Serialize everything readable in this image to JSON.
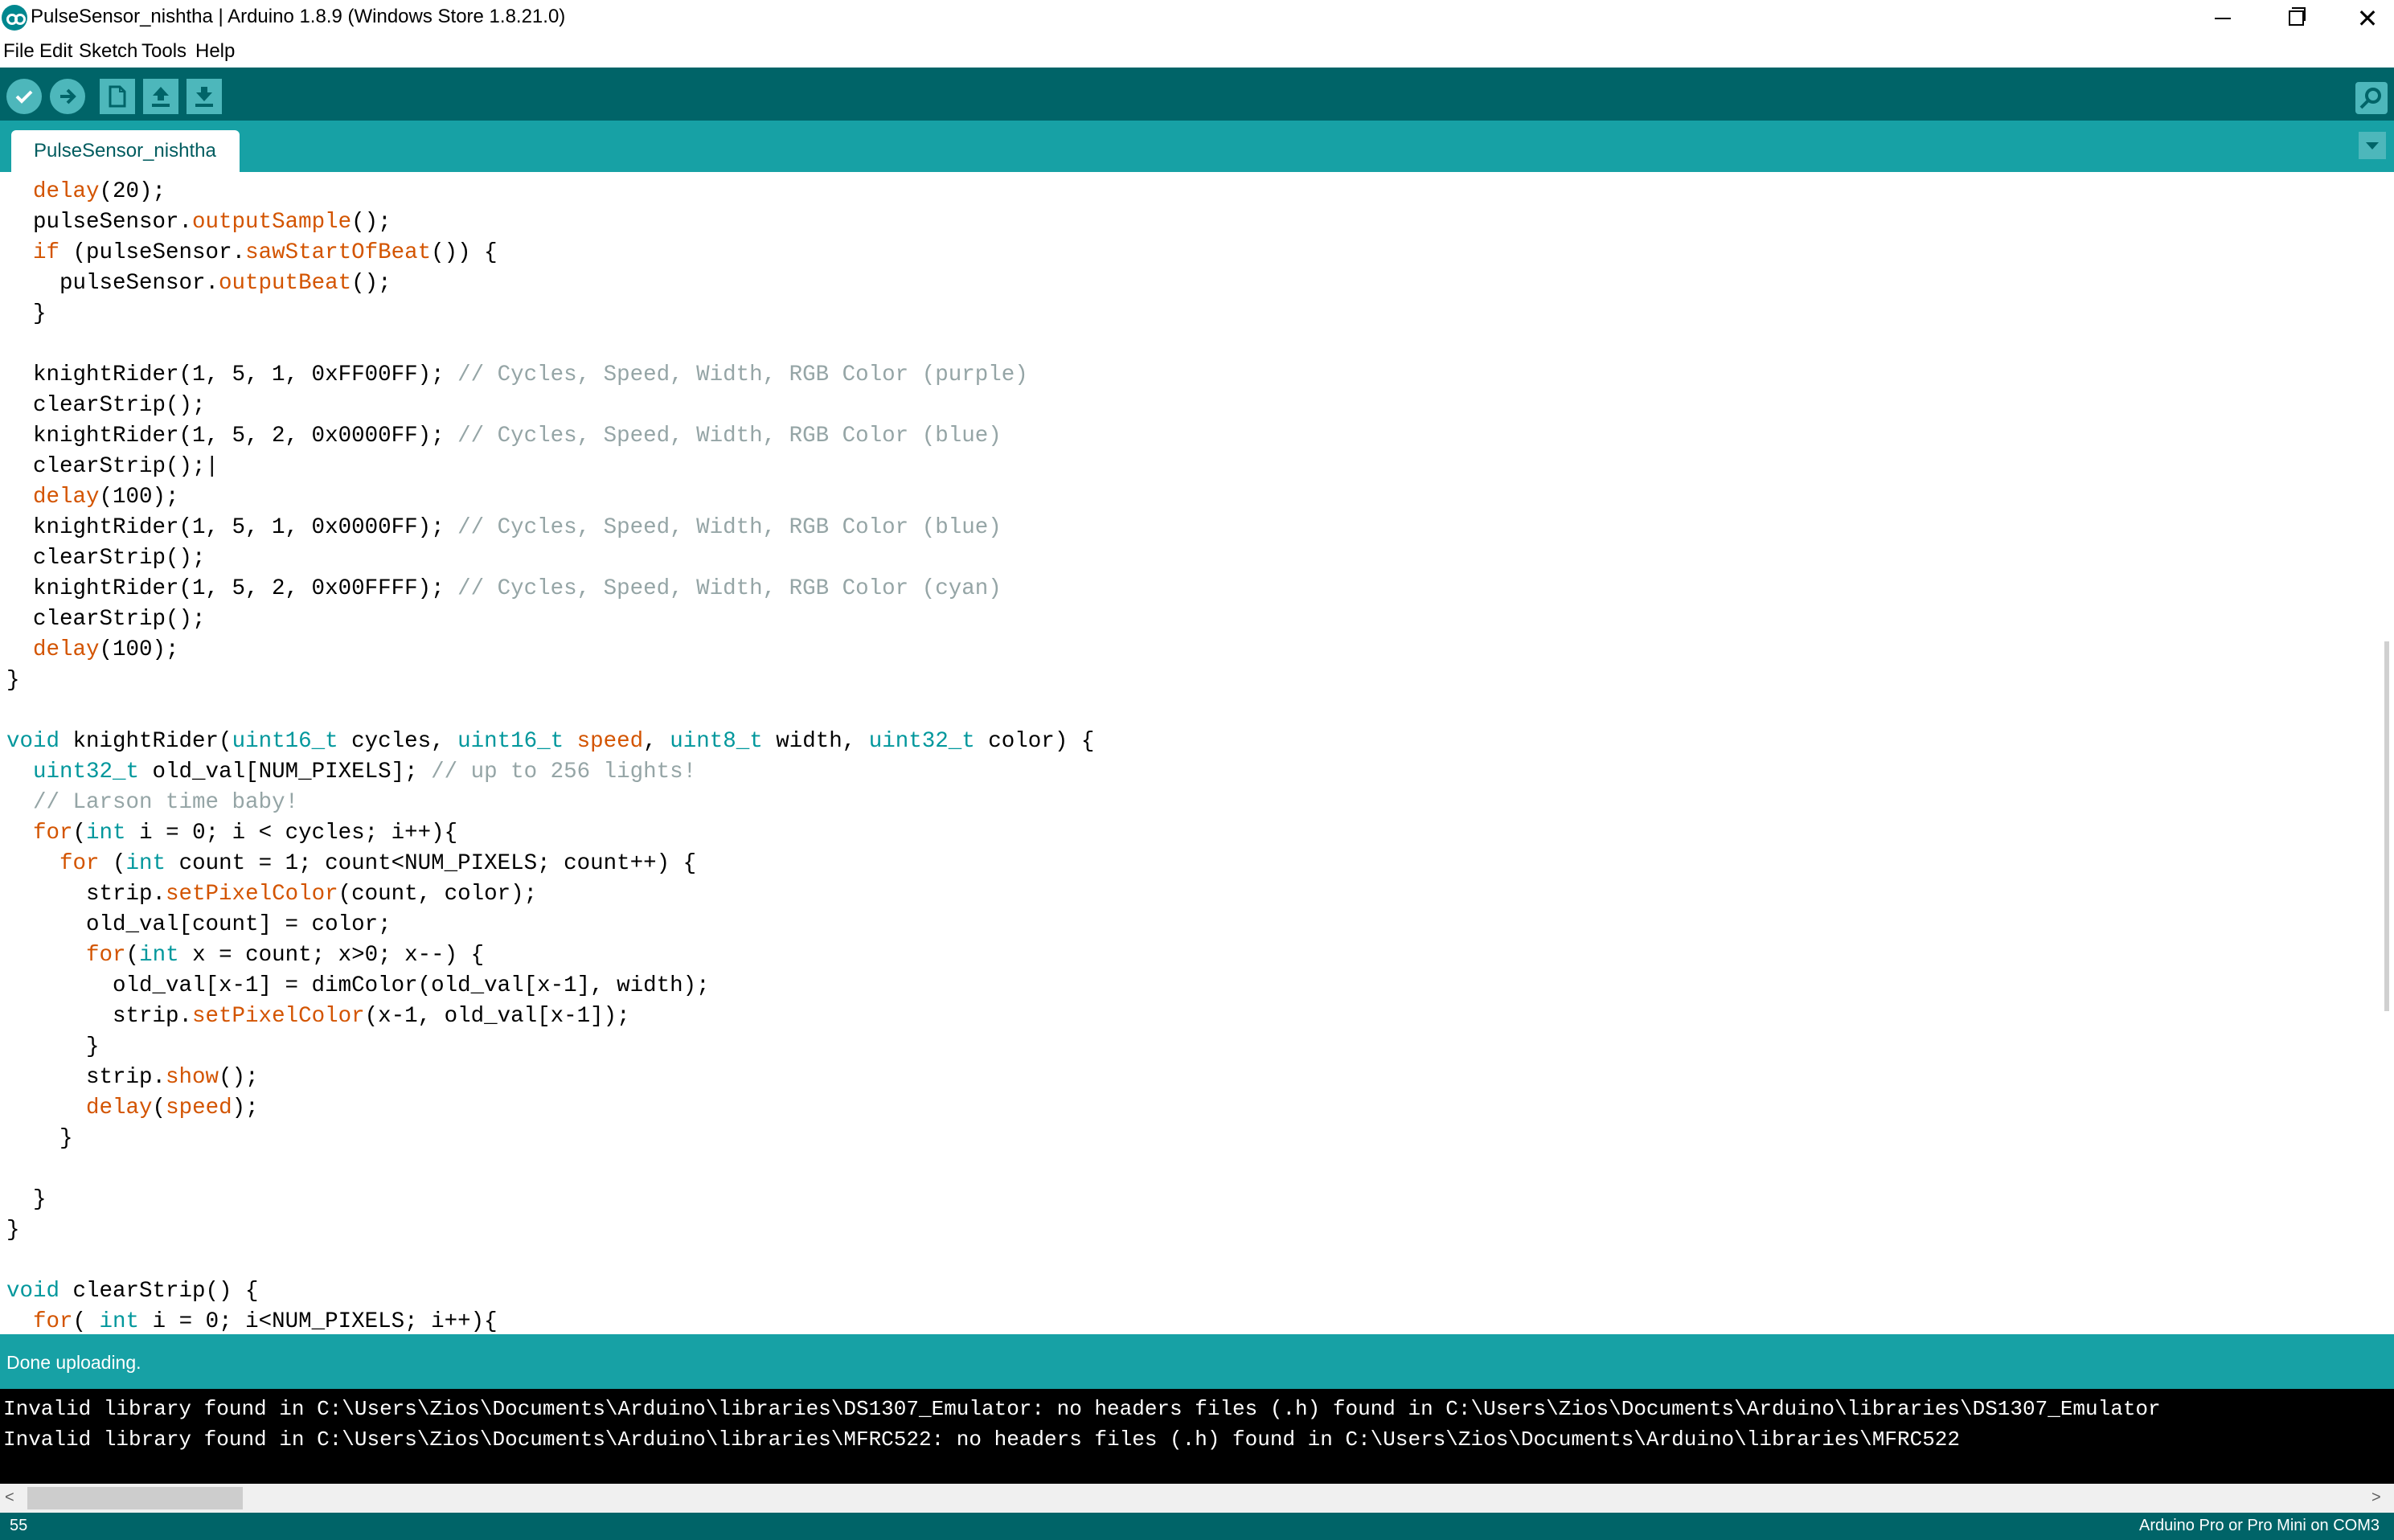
{
  "window": {
    "title": "PulseSensor_nishtha | Arduino 1.8.9 (Windows Store 1.8.21.0)",
    "minimize_glyph": "—",
    "close_glyph": "✕"
  },
  "menu": [
    "File",
    "Edit",
    "Sketch",
    "Tools",
    "Help"
  ],
  "toolbar": {
    "buttons": [
      "verify-icon",
      "upload-icon",
      "new-icon",
      "open-icon",
      "save-icon"
    ],
    "right_button": "serial-monitor-icon"
  },
  "tab": {
    "label": "PulseSensor_nishtha"
  },
  "colors": {
    "toolbar": "#006468",
    "tabbar": "#17a1a5",
    "keyword": "#d35400",
    "type": "#00979c",
    "comment": "#95a5a6"
  },
  "code_lines": [
    [
      [
        "  ",
        ""
      ],
      [
        "delay",
        "kw"
      ],
      [
        "(20);",
        ""
      ]
    ],
    [
      [
        "  pulseSensor.",
        ""
      ],
      [
        "outputSample",
        "kw"
      ],
      [
        "();",
        ""
      ]
    ],
    [
      [
        "  ",
        ""
      ],
      [
        "if",
        "kw"
      ],
      [
        " (pulseSensor.",
        ""
      ],
      [
        "sawStartOfBeat",
        "kw"
      ],
      [
        "()) {",
        ""
      ]
    ],
    [
      [
        "    pulseSensor.",
        ""
      ],
      [
        "outputBeat",
        "kw"
      ],
      [
        "();",
        ""
      ]
    ],
    [
      [
        "  }",
        ""
      ]
    ],
    [
      [
        "",
        ""
      ]
    ],
    [
      [
        "  knightRider(1, 5, 1, 0xFF00FF); ",
        ""
      ],
      [
        "// Cycles, Speed, Width, RGB Color (purple)",
        "cm"
      ]
    ],
    [
      [
        "  clearStrip();",
        ""
      ]
    ],
    [
      [
        "  knightRider(1, 5, 2, 0x0000FF); ",
        ""
      ],
      [
        "// Cycles, Speed, Width, RGB Color (blue)",
        "cm"
      ]
    ],
    [
      [
        "  clearStrip();|",
        ""
      ]
    ],
    [
      [
        "  ",
        ""
      ],
      [
        "delay",
        "kw"
      ],
      [
        "(100);",
        ""
      ]
    ],
    [
      [
        "  knightRider(1, 5, 1, 0x0000FF); ",
        ""
      ],
      [
        "// Cycles, Speed, Width, RGB Color (blue)",
        "cm"
      ]
    ],
    [
      [
        "  clearStrip();",
        ""
      ]
    ],
    [
      [
        "  knightRider(1, 5, 2, 0x00FFFF); ",
        ""
      ],
      [
        "// Cycles, Speed, Width, RGB Color (cyan)",
        "cm"
      ]
    ],
    [
      [
        "  clearStrip();",
        ""
      ]
    ],
    [
      [
        "  ",
        ""
      ],
      [
        "delay",
        "kw"
      ],
      [
        "(100);",
        ""
      ]
    ],
    [
      [
        "}",
        ""
      ]
    ],
    [
      [
        "",
        ""
      ]
    ],
    [
      [
        "void",
        "ty"
      ],
      [
        " knightRider(",
        ""
      ],
      [
        "uint16_t",
        "ty"
      ],
      [
        " cycles, ",
        ""
      ],
      [
        "uint16_t",
        "ty"
      ],
      [
        " ",
        ""
      ],
      [
        "speed",
        "kw"
      ],
      [
        ", ",
        ""
      ],
      [
        "uint8_t",
        "ty"
      ],
      [
        " width, ",
        ""
      ],
      [
        "uint32_t",
        "ty"
      ],
      [
        " color) {",
        ""
      ]
    ],
    [
      [
        "  ",
        ""
      ],
      [
        "uint32_t",
        "ty"
      ],
      [
        " old_val[NUM_PIXELS]; ",
        ""
      ],
      [
        "// up to 256 lights!",
        "cm"
      ]
    ],
    [
      [
        "  ",
        ""
      ],
      [
        "// Larson time baby!",
        "cm"
      ]
    ],
    [
      [
        "  ",
        ""
      ],
      [
        "for",
        "kw"
      ],
      [
        "(",
        ""
      ],
      [
        "int",
        "ty"
      ],
      [
        " i = 0; i < cycles; i++){",
        ""
      ]
    ],
    [
      [
        "    ",
        ""
      ],
      [
        "for",
        "kw"
      ],
      [
        " (",
        ""
      ],
      [
        "int",
        "ty"
      ],
      [
        " count = 1; count<NUM_PIXELS; count++) {",
        ""
      ]
    ],
    [
      [
        "      strip.",
        ""
      ],
      [
        "setPixelColor",
        "kw"
      ],
      [
        "(count, color);",
        ""
      ]
    ],
    [
      [
        "      old_val[count] = color;",
        ""
      ]
    ],
    [
      [
        "      ",
        ""
      ],
      [
        "for",
        "kw"
      ],
      [
        "(",
        ""
      ],
      [
        "int",
        "ty"
      ],
      [
        " x = count; x>0; x--) {",
        ""
      ]
    ],
    [
      [
        "        old_val[x-1] = dimColor(old_val[x-1], width);",
        ""
      ]
    ],
    [
      [
        "        strip.",
        ""
      ],
      [
        "setPixelColor",
        "kw"
      ],
      [
        "(x-1, old_val[x-1]);",
        ""
      ]
    ],
    [
      [
        "      }",
        ""
      ]
    ],
    [
      [
        "      strip.",
        ""
      ],
      [
        "show",
        "kw"
      ],
      [
        "();",
        ""
      ]
    ],
    [
      [
        "      ",
        ""
      ],
      [
        "delay",
        "kw"
      ],
      [
        "(",
        ""
      ],
      [
        "speed",
        "kw"
      ],
      [
        ");",
        ""
      ]
    ],
    [
      [
        "    }",
        ""
      ]
    ],
    [
      [
        "",
        ""
      ]
    ],
    [
      [
        "  }",
        ""
      ]
    ],
    [
      [
        "}",
        ""
      ]
    ],
    [
      [
        "",
        ""
      ]
    ],
    [
      [
        "void",
        "ty"
      ],
      [
        " clearStrip() {",
        ""
      ]
    ],
    [
      [
        "  ",
        ""
      ],
      [
        "for",
        "kw"
      ],
      [
        "( ",
        ""
      ],
      [
        "int",
        "ty"
      ],
      [
        " i = 0; i<NUM_PIXELS; i++){",
        ""
      ]
    ]
  ],
  "status": {
    "message": "Done uploading."
  },
  "console_lines": [
    "Invalid library found in C:\\Users\\Zios\\Documents\\Arduino\\libraries\\DS1307_Emulator: no headers files (.h) found in C:\\Users\\Zios\\Documents\\Arduino\\libraries\\DS1307_Emulator",
    "Invalid library found in C:\\Users\\Zios\\Documents\\Arduino\\libraries\\MFRC522: no headers files (.h) found in C:\\Users\\Zios\\Documents\\Arduino\\libraries\\MFRC522"
  ],
  "footer": {
    "line_number": "55",
    "board": "Arduino Pro or Pro Mini on COM3"
  },
  "scroll_glyphs": {
    "left": "<",
    "right": ">"
  }
}
